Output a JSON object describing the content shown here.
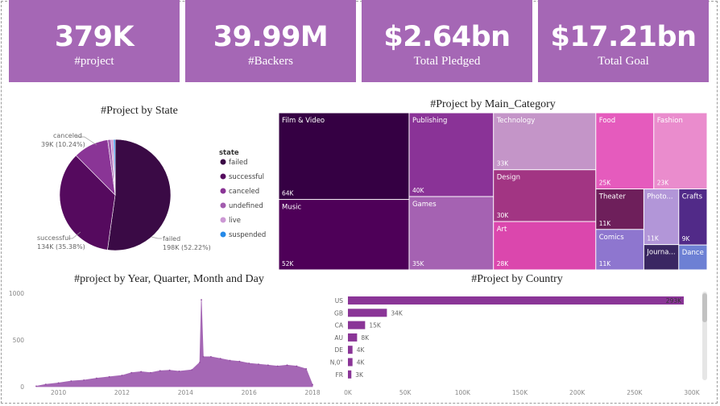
{
  "kpis": [
    {
      "value": "379K",
      "label": "#project"
    },
    {
      "value": "39.99M",
      "label": "#Backers"
    },
    {
      "value": "$2.64bn",
      "label": "Total Pledged"
    },
    {
      "value": "$17.21bn",
      "label": "Total Goal"
    }
  ],
  "pie": {
    "title": "#Project by State",
    "legend_title": "state",
    "callouts": {
      "canceled_name": "canceled",
      "canceled_value": "39K (10.24%)",
      "successful_name": "successful",
      "successful_value": "134K (35.38%)",
      "failed_name": "failed",
      "failed_value": "198K (52.22%)"
    }
  },
  "treemap": {
    "title": "#Project by Main_Category"
  },
  "line": {
    "title": "#project by Year, Quarter, Month and Day"
  },
  "bar": {
    "title": "#Project by Country"
  },
  "chart_data": [
    {
      "type": "pie",
      "title": "#Project by State",
      "legend": "right",
      "slices": [
        {
          "name": "failed",
          "value": 198,
          "pct": 52.22,
          "color": "#3a0a45"
        },
        {
          "name": "successful",
          "value": 134,
          "pct": 35.38,
          "color": "#550a5e"
        },
        {
          "name": "canceled",
          "value": 39,
          "pct": 10.24,
          "color": "#8a3596"
        },
        {
          "name": "undefined",
          "value": 3.6,
          "color": "#a25cae"
        },
        {
          "name": "live",
          "value": 2.8,
          "color": "#cc98d4"
        },
        {
          "name": "suspended",
          "value": 1.8,
          "color": "#2589e8"
        }
      ]
    },
    {
      "type": "treemap",
      "title": "#Project by Main_Category",
      "items": [
        {
          "name": "Film & Video",
          "value": 64,
          "label": "64K",
          "color": "#350043"
        },
        {
          "name": "Music",
          "value": 52,
          "label": "52K",
          "color": "#4e0058"
        },
        {
          "name": "Publishing",
          "value": 40,
          "label": "40K",
          "color": "#8a3397"
        },
        {
          "name": "Games",
          "value": 35,
          "label": "35K",
          "color": "#a562b2"
        },
        {
          "name": "Technology",
          "value": 33,
          "label": "33K",
          "color": "#c495c8"
        },
        {
          "name": "Design",
          "value": 30,
          "label": "30K",
          "color": "#a23583"
        },
        {
          "name": "Art",
          "value": 28,
          "label": "28K",
          "color": "#db47ad"
        },
        {
          "name": "Food",
          "value": 25,
          "label": "25K",
          "color": "#e55bbd"
        },
        {
          "name": "Fashion",
          "value": 23,
          "label": "23K",
          "color": "#ea8ccd"
        },
        {
          "name": "Theater",
          "value": 11,
          "label": "11K",
          "color": "#6e1f5b"
        },
        {
          "name": "Photo...",
          "value": 11,
          "label": "11K",
          "color": "#b296d8"
        },
        {
          "name": "Crafts",
          "value": 9,
          "label": "9K",
          "color": "#512a88"
        },
        {
          "name": "Comics",
          "value": 11,
          "label": "11K",
          "color": "#8e76cf"
        },
        {
          "name": "Journa...",
          "value": 5,
          "label": "",
          "color": "#3a2762"
        },
        {
          "name": "Dance",
          "value": 4,
          "label": "",
          "color": "#6d80d4"
        }
      ]
    },
    {
      "type": "area",
      "title": "#project by Year, Quarter, Month and Day",
      "color": "#a567b5",
      "x_range": [
        2009.3,
        2018.1
      ],
      "ylim": [
        0,
        1000
      ],
      "y_ticks": [
        0,
        500,
        1000
      ],
      "x_ticks": [
        2010,
        2012,
        2014,
        2016,
        2018
      ],
      "points": [
        {
          "x": 2009.3,
          "y": 5
        },
        {
          "x": 2009.6,
          "y": 25
        },
        {
          "x": 2010.0,
          "y": 40
        },
        {
          "x": 2010.4,
          "y": 60
        },
        {
          "x": 2010.8,
          "y": 70
        },
        {
          "x": 2011.2,
          "y": 90
        },
        {
          "x": 2011.6,
          "y": 105
        },
        {
          "x": 2012.0,
          "y": 120
        },
        {
          "x": 2012.3,
          "y": 150
        },
        {
          "x": 2012.6,
          "y": 160
        },
        {
          "x": 2012.9,
          "y": 150
        },
        {
          "x": 2013.2,
          "y": 170
        },
        {
          "x": 2013.5,
          "y": 175
        },
        {
          "x": 2013.8,
          "y": 165
        },
        {
          "x": 2014.2,
          "y": 180
        },
        {
          "x": 2014.45,
          "y": 260
        },
        {
          "x": 2014.5,
          "y": 930
        },
        {
          "x": 2014.56,
          "y": 320
        },
        {
          "x": 2014.8,
          "y": 320
        },
        {
          "x": 2015.1,
          "y": 300
        },
        {
          "x": 2015.4,
          "y": 280
        },
        {
          "x": 2015.7,
          "y": 270
        },
        {
          "x": 2016.0,
          "y": 250
        },
        {
          "x": 2016.3,
          "y": 240
        },
        {
          "x": 2016.6,
          "y": 230
        },
        {
          "x": 2016.9,
          "y": 220
        },
        {
          "x": 2017.2,
          "y": 230
        },
        {
          "x": 2017.5,
          "y": 220
        },
        {
          "x": 2017.8,
          "y": 190
        },
        {
          "x": 2018.0,
          "y": 20
        }
      ]
    },
    {
      "type": "bar",
      "orientation": "horizontal",
      "title": "#Project by Country",
      "color": "#8a3597",
      "categories": [
        "US",
        "GB",
        "CA",
        "AU",
        "DE",
        "N,0\"",
        "FR"
      ],
      "values": [
        293,
        34,
        15,
        8,
        4,
        4,
        3
      ],
      "value_labels": [
        "293K",
        "34K",
        "15K",
        "8K",
        "4K",
        "4K",
        "3K"
      ],
      "x_ticks": [
        "0K",
        "50K",
        "100K",
        "150K",
        "200K",
        "250K",
        "300K"
      ],
      "xlim": [
        0,
        300
      ]
    }
  ]
}
